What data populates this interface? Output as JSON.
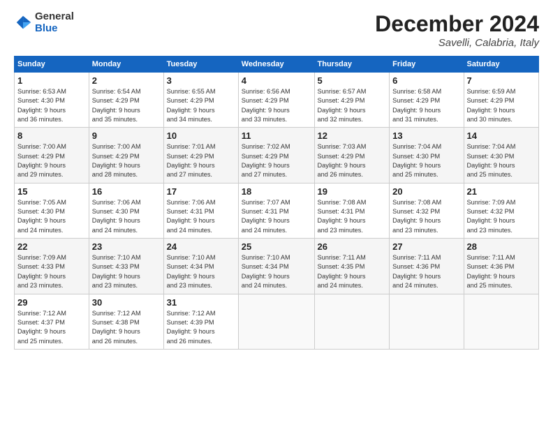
{
  "header": {
    "logo_line1": "General",
    "logo_line2": "Blue",
    "month": "December 2024",
    "location": "Savelli, Calabria, Italy"
  },
  "weekdays": [
    "Sunday",
    "Monday",
    "Tuesday",
    "Wednesday",
    "Thursday",
    "Friday",
    "Saturday"
  ],
  "weeks": [
    [
      {
        "day": "1",
        "detail": "Sunrise: 6:53 AM\nSunset: 4:30 PM\nDaylight: 9 hours\nand 36 minutes."
      },
      {
        "day": "2",
        "detail": "Sunrise: 6:54 AM\nSunset: 4:29 PM\nDaylight: 9 hours\nand 35 minutes."
      },
      {
        "day": "3",
        "detail": "Sunrise: 6:55 AM\nSunset: 4:29 PM\nDaylight: 9 hours\nand 34 minutes."
      },
      {
        "day": "4",
        "detail": "Sunrise: 6:56 AM\nSunset: 4:29 PM\nDaylight: 9 hours\nand 33 minutes."
      },
      {
        "day": "5",
        "detail": "Sunrise: 6:57 AM\nSunset: 4:29 PM\nDaylight: 9 hours\nand 32 minutes."
      },
      {
        "day": "6",
        "detail": "Sunrise: 6:58 AM\nSunset: 4:29 PM\nDaylight: 9 hours\nand 31 minutes."
      },
      {
        "day": "7",
        "detail": "Sunrise: 6:59 AM\nSunset: 4:29 PM\nDaylight: 9 hours\nand 30 minutes."
      }
    ],
    [
      {
        "day": "8",
        "detail": "Sunrise: 7:00 AM\nSunset: 4:29 PM\nDaylight: 9 hours\nand 29 minutes."
      },
      {
        "day": "9",
        "detail": "Sunrise: 7:00 AM\nSunset: 4:29 PM\nDaylight: 9 hours\nand 28 minutes."
      },
      {
        "day": "10",
        "detail": "Sunrise: 7:01 AM\nSunset: 4:29 PM\nDaylight: 9 hours\nand 27 minutes."
      },
      {
        "day": "11",
        "detail": "Sunrise: 7:02 AM\nSunset: 4:29 PM\nDaylight: 9 hours\nand 27 minutes."
      },
      {
        "day": "12",
        "detail": "Sunrise: 7:03 AM\nSunset: 4:29 PM\nDaylight: 9 hours\nand 26 minutes."
      },
      {
        "day": "13",
        "detail": "Sunrise: 7:04 AM\nSunset: 4:30 PM\nDaylight: 9 hours\nand 25 minutes."
      },
      {
        "day": "14",
        "detail": "Sunrise: 7:04 AM\nSunset: 4:30 PM\nDaylight: 9 hours\nand 25 minutes."
      }
    ],
    [
      {
        "day": "15",
        "detail": "Sunrise: 7:05 AM\nSunset: 4:30 PM\nDaylight: 9 hours\nand 24 minutes."
      },
      {
        "day": "16",
        "detail": "Sunrise: 7:06 AM\nSunset: 4:30 PM\nDaylight: 9 hours\nand 24 minutes."
      },
      {
        "day": "17",
        "detail": "Sunrise: 7:06 AM\nSunset: 4:31 PM\nDaylight: 9 hours\nand 24 minutes."
      },
      {
        "day": "18",
        "detail": "Sunrise: 7:07 AM\nSunset: 4:31 PM\nDaylight: 9 hours\nand 24 minutes."
      },
      {
        "day": "19",
        "detail": "Sunrise: 7:08 AM\nSunset: 4:31 PM\nDaylight: 9 hours\nand 23 minutes."
      },
      {
        "day": "20",
        "detail": "Sunrise: 7:08 AM\nSunset: 4:32 PM\nDaylight: 9 hours\nand 23 minutes."
      },
      {
        "day": "21",
        "detail": "Sunrise: 7:09 AM\nSunset: 4:32 PM\nDaylight: 9 hours\nand 23 minutes."
      }
    ],
    [
      {
        "day": "22",
        "detail": "Sunrise: 7:09 AM\nSunset: 4:33 PM\nDaylight: 9 hours\nand 23 minutes."
      },
      {
        "day": "23",
        "detail": "Sunrise: 7:10 AM\nSunset: 4:33 PM\nDaylight: 9 hours\nand 23 minutes."
      },
      {
        "day": "24",
        "detail": "Sunrise: 7:10 AM\nSunset: 4:34 PM\nDaylight: 9 hours\nand 23 minutes."
      },
      {
        "day": "25",
        "detail": "Sunrise: 7:10 AM\nSunset: 4:34 PM\nDaylight: 9 hours\nand 24 minutes."
      },
      {
        "day": "26",
        "detail": "Sunrise: 7:11 AM\nSunset: 4:35 PM\nDaylight: 9 hours\nand 24 minutes."
      },
      {
        "day": "27",
        "detail": "Sunrise: 7:11 AM\nSunset: 4:36 PM\nDaylight: 9 hours\nand 24 minutes."
      },
      {
        "day": "28",
        "detail": "Sunrise: 7:11 AM\nSunset: 4:36 PM\nDaylight: 9 hours\nand 25 minutes."
      }
    ],
    [
      {
        "day": "29",
        "detail": "Sunrise: 7:12 AM\nSunset: 4:37 PM\nDaylight: 9 hours\nand 25 minutes."
      },
      {
        "day": "30",
        "detail": "Sunrise: 7:12 AM\nSunset: 4:38 PM\nDaylight: 9 hours\nand 26 minutes."
      },
      {
        "day": "31",
        "detail": "Sunrise: 7:12 AM\nSunset: 4:39 PM\nDaylight: 9 hours\nand 26 minutes."
      },
      null,
      null,
      null,
      null
    ]
  ]
}
